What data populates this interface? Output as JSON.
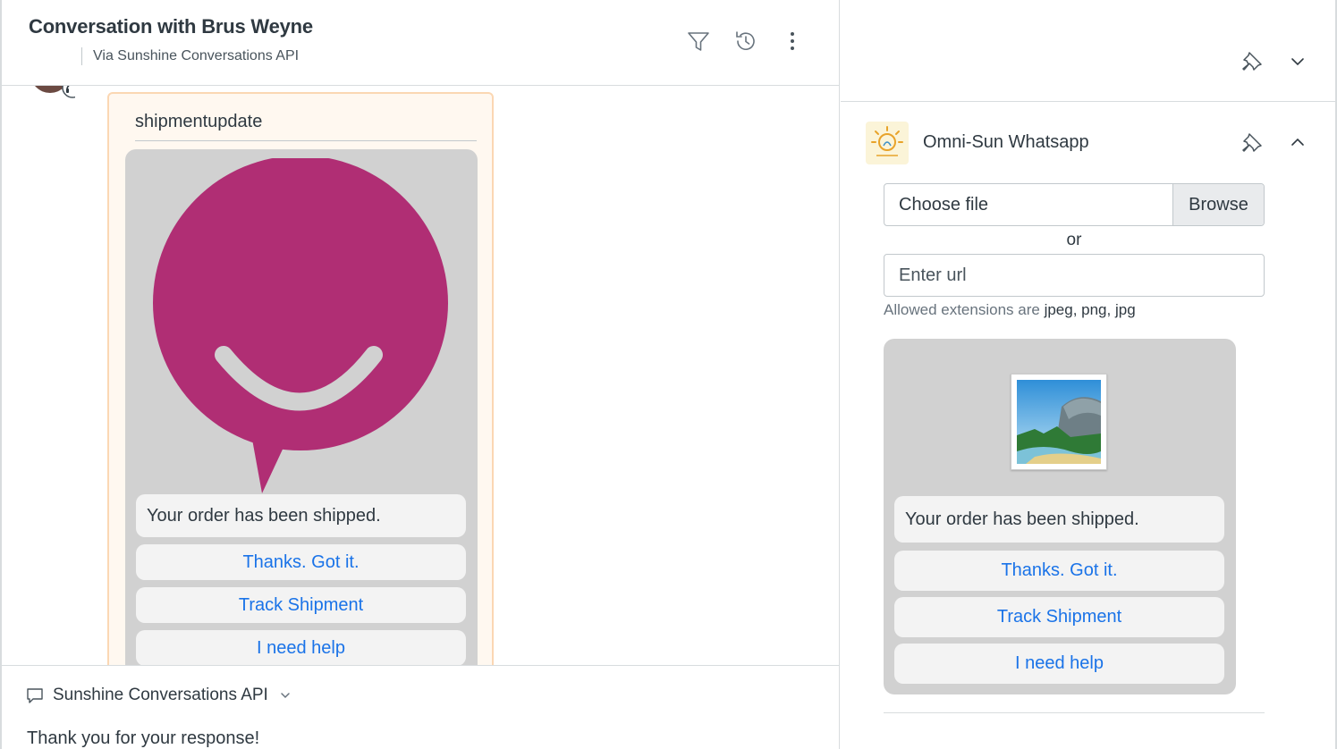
{
  "conversation": {
    "title": "Conversation with Brus Weyne",
    "subtitle": "Via Sunshine Conversations API",
    "message": {
      "template_name": "shipmentupdate",
      "body": "Your order has been shipped.",
      "buttons": [
        "Thanks. Got it.",
        "Track Shipment",
        "I need help"
      ]
    }
  },
  "composer": {
    "channel": "Sunshine Conversations API",
    "reply_text": "Thank you for your response!"
  },
  "app": {
    "name": "Omni-Sun Whatsapp",
    "file_label": "Choose file",
    "browse_label": "Browse",
    "or_label": "or",
    "url_placeholder": "Enter url",
    "hint_prefix": "Allowed extensions are",
    "hint_extensions": "jpeg, png, jpg",
    "preview": {
      "body": "Your order has been shipped.",
      "buttons": [
        "Thanks. Got it.",
        "Track Shipment",
        "I need help"
      ]
    }
  },
  "colors": {
    "brand_magenta": "#b02e74",
    "link_blue": "#1a73e8",
    "bubble_bg": "#fff8f0",
    "bubble_border": "#fbd7b3",
    "card_bg": "#d1d1d1"
  },
  "icons": [
    "filter-icon",
    "history-icon",
    "more-options-icon",
    "pin-icon",
    "chevron-down-icon",
    "chevron-up-icon",
    "chat-bubble-icon",
    "image-placeholder-icon",
    "sun-logo-icon"
  ]
}
